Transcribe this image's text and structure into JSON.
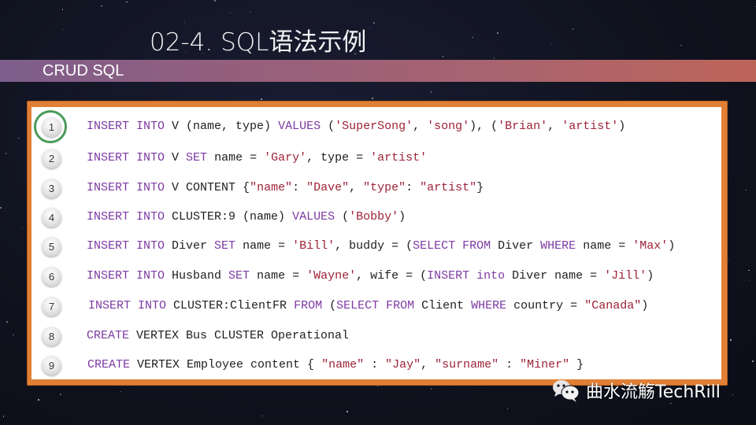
{
  "slide": {
    "title": "02-4. SQL语法示例",
    "section_label": "CRUD SQL"
  },
  "code_listing": {
    "highlighted_line": 1,
    "lines": [
      {
        "number": "1",
        "tokens": [
          {
            "t": "INSERT INTO",
            "k": "kw"
          },
          {
            "t": " V (name, type) ",
            "k": ""
          },
          {
            "t": "VALUES",
            "k": "kw"
          },
          {
            "t": " (",
            "k": ""
          },
          {
            "t": "'SuperSong'",
            "k": "str"
          },
          {
            "t": ", ",
            "k": ""
          },
          {
            "t": "'song'",
            "k": "str"
          },
          {
            "t": "), (",
            "k": ""
          },
          {
            "t": "'Brian'",
            "k": "str"
          },
          {
            "t": ", ",
            "k": ""
          },
          {
            "t": "'artist'",
            "k": "str"
          },
          {
            "t": ")",
            "k": ""
          }
        ]
      },
      {
        "number": "2",
        "tokens": [
          {
            "t": "INSERT INTO",
            "k": "kw"
          },
          {
            "t": " V ",
            "k": ""
          },
          {
            "t": "SET",
            "k": "kw"
          },
          {
            "t": " name = ",
            "k": ""
          },
          {
            "t": "'Gary'",
            "k": "str"
          },
          {
            "t": ", type = ",
            "k": ""
          },
          {
            "t": "'artist'",
            "k": "str"
          }
        ]
      },
      {
        "number": "3",
        "tokens": [
          {
            "t": "INSERT INTO",
            "k": "kw"
          },
          {
            "t": " V CONTENT {",
            "k": ""
          },
          {
            "t": "\"name\"",
            "k": "str"
          },
          {
            "t": ": ",
            "k": ""
          },
          {
            "t": "\"Dave\"",
            "k": "str"
          },
          {
            "t": ", ",
            "k": ""
          },
          {
            "t": "\"type\"",
            "k": "str"
          },
          {
            "t": ": ",
            "k": ""
          },
          {
            "t": "\"artist\"",
            "k": "str"
          },
          {
            "t": "}",
            "k": ""
          }
        ]
      },
      {
        "number": "4",
        "tokens": [
          {
            "t": "INSERT INTO",
            "k": "kw"
          },
          {
            "t": " CLUSTER:9 (name) ",
            "k": ""
          },
          {
            "t": "VALUES",
            "k": "kw"
          },
          {
            "t": " (",
            "k": ""
          },
          {
            "t": "'Bobby'",
            "k": "str"
          },
          {
            "t": ")",
            "k": ""
          }
        ]
      },
      {
        "number": "5",
        "tokens": [
          {
            "t": "INSERT INTO",
            "k": "kw"
          },
          {
            "t": " Diver ",
            "k": ""
          },
          {
            "t": "SET",
            "k": "kw"
          },
          {
            "t": " name = ",
            "k": ""
          },
          {
            "t": "'Bill'",
            "k": "str"
          },
          {
            "t": ", buddy = (",
            "k": ""
          },
          {
            "t": "SELECT FROM",
            "k": "kw"
          },
          {
            "t": " Diver ",
            "k": ""
          },
          {
            "t": "WHERE",
            "k": "kw"
          },
          {
            "t": " name = ",
            "k": ""
          },
          {
            "t": "'Max'",
            "k": "str"
          },
          {
            "t": ")",
            "k": ""
          }
        ]
      },
      {
        "number": "6",
        "tokens": [
          {
            "t": "INSERT INTO",
            "k": "kw"
          },
          {
            "t": " Husband ",
            "k": ""
          },
          {
            "t": "SET",
            "k": "kw"
          },
          {
            "t": " name = ",
            "k": ""
          },
          {
            "t": "'Wayne'",
            "k": "str"
          },
          {
            "t": ", wife = (",
            "k": ""
          },
          {
            "t": "INSERT into",
            "k": "kw"
          },
          {
            "t": " Diver name = ",
            "k": ""
          },
          {
            "t": "'Jill'",
            "k": "str"
          },
          {
            "t": ")",
            "k": ""
          }
        ]
      },
      {
        "number": "7",
        "tokens": [
          {
            "t": "INSERT INTO",
            "k": "kw"
          },
          {
            "t": " CLUSTER:ClientFR ",
            "k": ""
          },
          {
            "t": "FROM",
            "k": "kw"
          },
          {
            "t": " (",
            "k": ""
          },
          {
            "t": "SELECT FROM",
            "k": "kw"
          },
          {
            "t": " Client ",
            "k": ""
          },
          {
            "t": "WHERE",
            "k": "kw"
          },
          {
            "t": " country = ",
            "k": ""
          },
          {
            "t": "\"Canada\"",
            "k": "str"
          },
          {
            "t": ")",
            "k": ""
          }
        ]
      },
      {
        "number": "8",
        "tokens": [
          {
            "t": "CREATE",
            "k": "kw"
          },
          {
            "t": " VERTEX Bus CLUSTER Operational",
            "k": ""
          }
        ]
      },
      {
        "number": "9",
        "tokens": [
          {
            "t": "CREATE",
            "k": "kw"
          },
          {
            "t": " VERTEX Employee content { ",
            "k": ""
          },
          {
            "t": "\"name\"",
            "k": "str"
          },
          {
            "t": " : ",
            "k": ""
          },
          {
            "t": "\"Jay\"",
            "k": "str"
          },
          {
            "t": ", ",
            "k": ""
          },
          {
            "t": "\"surname\"",
            "k": "str"
          },
          {
            "t": " : ",
            "k": ""
          },
          {
            "t": "\"Miner\"",
            "k": "str"
          },
          {
            "t": " }",
            "k": ""
          }
        ]
      }
    ]
  },
  "watermark": {
    "icon": "wechat-icon",
    "text": "曲水流觞TechRill"
  },
  "colors": {
    "keyword": "#7d3aa3",
    "string": "#9c2235",
    "frame": "#e07f35",
    "highlight_ring": "#4a9a58"
  }
}
